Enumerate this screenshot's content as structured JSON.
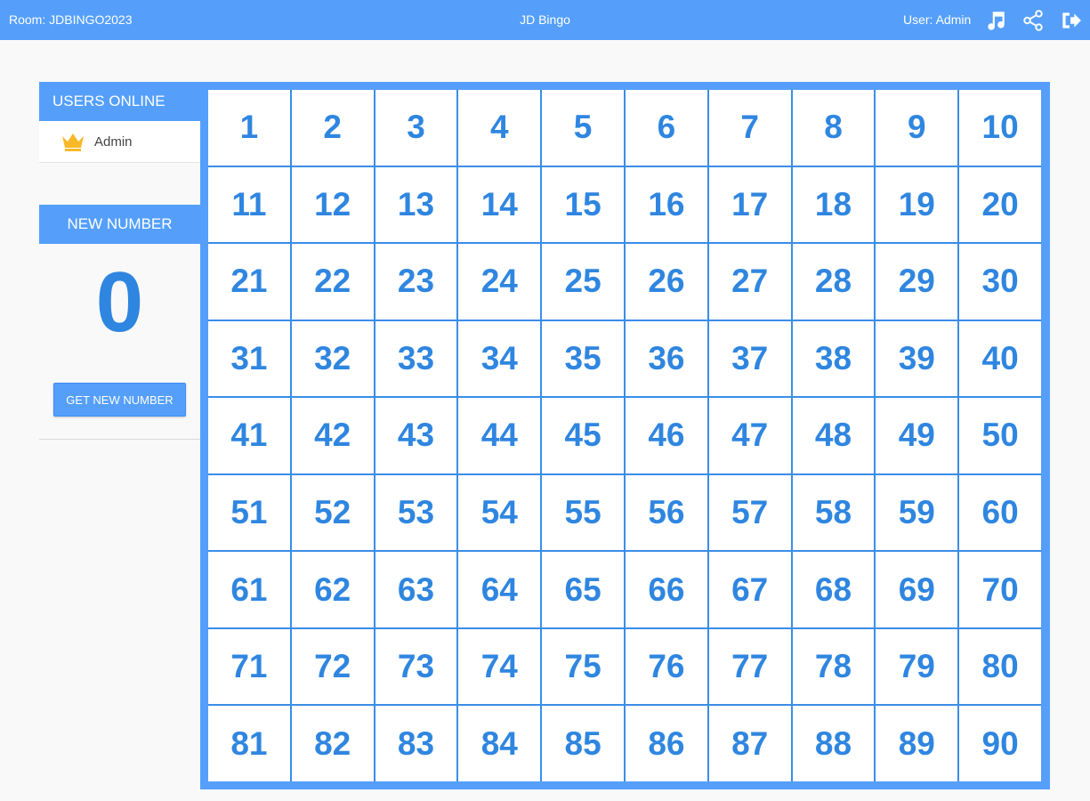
{
  "topbar": {
    "room_label": "Room: JDBINGO2023",
    "title": "JD Bingo",
    "user_label": "User: Admin",
    "icons": [
      "music-icon",
      "share-icon",
      "logout-icon"
    ]
  },
  "users_panel": {
    "header": "USERS ONLINE",
    "users": [
      {
        "name": "Admin",
        "icon": "crown-icon"
      }
    ]
  },
  "new_number_panel": {
    "header": "NEW NUMBER",
    "current": "0",
    "button_label": "GET NEW NUMBER"
  },
  "board": {
    "numbers": [
      1,
      2,
      3,
      4,
      5,
      6,
      7,
      8,
      9,
      10,
      11,
      12,
      13,
      14,
      15,
      16,
      17,
      18,
      19,
      20,
      21,
      22,
      23,
      24,
      25,
      26,
      27,
      28,
      29,
      30,
      31,
      32,
      33,
      34,
      35,
      36,
      37,
      38,
      39,
      40,
      41,
      42,
      43,
      44,
      45,
      46,
      47,
      48,
      49,
      50,
      51,
      52,
      53,
      54,
      55,
      56,
      57,
      58,
      59,
      60,
      61,
      62,
      63,
      64,
      65,
      66,
      67,
      68,
      69,
      70,
      71,
      72,
      73,
      74,
      75,
      76,
      77,
      78,
      79,
      80,
      81,
      82,
      83,
      84,
      85,
      86,
      87,
      88,
      89,
      90
    ]
  },
  "colors": {
    "accent": "#559ffb",
    "number_text": "#2f86e0",
    "crown": "#f7b928",
    "background": "#f9f9f9"
  }
}
